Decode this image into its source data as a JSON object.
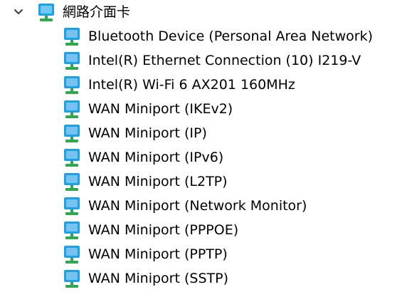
{
  "tree": {
    "category": {
      "label": "網路介面卡",
      "expanded": true,
      "icon": "network-adapter-icon"
    },
    "devices": [
      {
        "label": "Bluetooth Device (Personal Area Network)",
        "icon": "network-adapter-icon"
      },
      {
        "label": "Intel(R) Ethernet Connection (10) I219-V",
        "icon": "network-adapter-icon"
      },
      {
        "label": "Intel(R) Wi-Fi 6 AX201 160MHz",
        "icon": "network-adapter-icon"
      },
      {
        "label": "WAN Miniport (IKEv2)",
        "icon": "network-adapter-icon"
      },
      {
        "label": "WAN Miniport (IP)",
        "icon": "network-adapter-icon"
      },
      {
        "label": "WAN Miniport (IPv6)",
        "icon": "network-adapter-icon"
      },
      {
        "label": "WAN Miniport (L2TP)",
        "icon": "network-adapter-icon"
      },
      {
        "label": "WAN Miniport (Network Monitor)",
        "icon": "network-adapter-icon"
      },
      {
        "label": "WAN Miniport (PPPOE)",
        "icon": "network-adapter-icon"
      },
      {
        "label": "WAN Miniport (PPTP)",
        "icon": "network-adapter-icon"
      },
      {
        "label": "WAN Miniport (SSTP)",
        "icon": "network-adapter-icon"
      }
    ]
  },
  "colors": {
    "icon_monitor": "#1aa1e6",
    "icon_monitor_dark": "#0a73c2",
    "icon_stand": "#30a84f",
    "icon_screen_light": "#8fd4f8",
    "expander": "#3c3c3c"
  }
}
